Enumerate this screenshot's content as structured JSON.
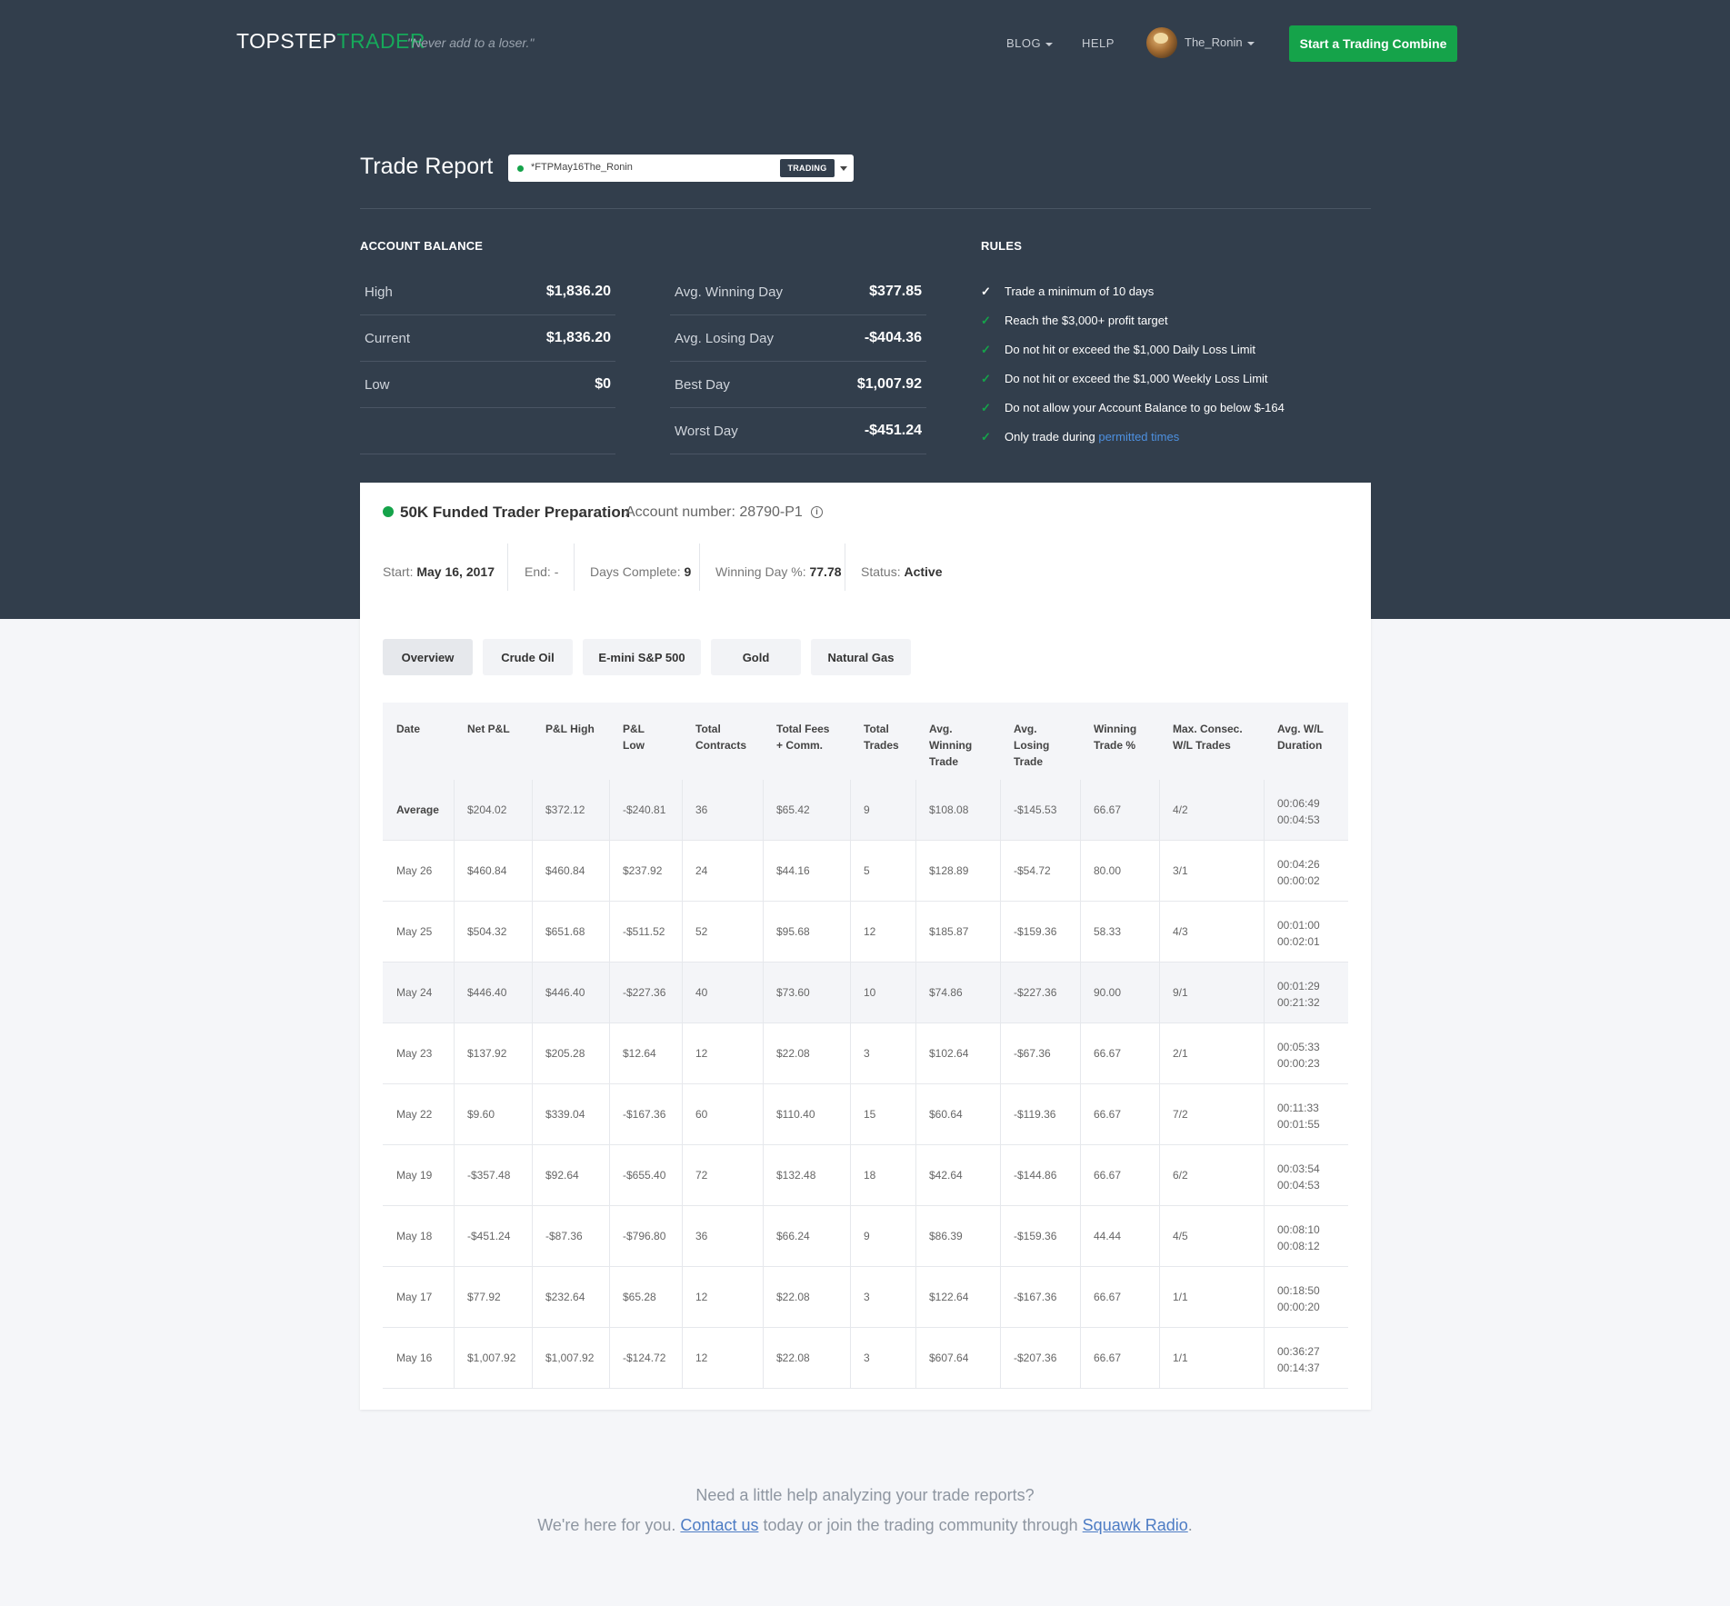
{
  "nav": {
    "logo_main": "TOPSTEP",
    "logo_accent": "TRADER",
    "tagline": "\"Never add to a loser.\"",
    "blog": "BLOG",
    "help": "HELP",
    "user": "The_Ronin",
    "cta": "Start a Trading Combine"
  },
  "report": {
    "title": "Trade Report",
    "account_select": "*FTPMay16The_Ronin",
    "account_badge": "TRADING"
  },
  "balance": {
    "heading": "ACCOUNT BALANCE",
    "left": [
      {
        "label": "High",
        "value": "$1,836.20"
      },
      {
        "label": "Current",
        "value": "$1,836.20"
      },
      {
        "label": "Low",
        "value": "$0"
      }
    ],
    "right": [
      {
        "label": "Avg. Winning Day",
        "value": "$377.85"
      },
      {
        "label": "Avg. Losing Day",
        "value": "-$404.36"
      },
      {
        "label": "Best Day",
        "value": "$1,007.92"
      },
      {
        "label": "Worst Day",
        "value": "-$451.24"
      }
    ]
  },
  "rules": {
    "heading": "RULES",
    "items": [
      "Trade a minimum of 10 days",
      "Reach the $3,000+ profit target",
      "Do not hit or exceed the $1,000 Daily Loss Limit",
      "Do not hit or exceed the $1,000 Weekly Loss Limit",
      "Do not allow your Account Balance to go below $-164"
    ],
    "last_prefix": "Only trade during ",
    "last_link": "permitted times"
  },
  "program": {
    "name": "50K Funded Trader Preparation",
    "account_number": "Account number: 28790-P1",
    "status_color": "#15a34a",
    "start_label": "Start:",
    "start": "May 16, 2017",
    "end_label": "End:",
    "end": "-",
    "days_label": "Days Complete:",
    "days": "9",
    "winpct_label": "Winning Day %:",
    "winpct": "77.78",
    "status_label": "Status:",
    "status": "Active"
  },
  "tabs": [
    "Overview",
    "Crude Oil",
    "E-mini S&P 500",
    "Gold",
    "Natural Gas"
  ],
  "table": {
    "headers": [
      "Date",
      "Net P&L",
      "P&L High",
      "P&L\nLow",
      "Total\nContracts",
      "Total Fees\n+ Comm.",
      "Total\nTrades",
      "Avg.\nWinning\nTrade",
      "Avg.\nLosing\nTrade",
      "Winning\nTrade %",
      "Max. Consec.\nW/L Trades",
      "Avg. W/L\nDuration"
    ],
    "rows": [
      [
        "Average",
        "$204.02",
        "$372.12",
        "-$240.81",
        "36",
        "$65.42",
        "9",
        "$108.08",
        "-$145.53",
        "66.67",
        "4/2",
        "00:06:49\n00:04:53"
      ],
      [
        "May 26",
        "$460.84",
        "$460.84",
        "$237.92",
        "24",
        "$44.16",
        "5",
        "$128.89",
        "-$54.72",
        "80.00",
        "3/1",
        "00:04:26\n00:00:02"
      ],
      [
        "May 25",
        "$504.32",
        "$651.68",
        "-$511.52",
        "52",
        "$95.68",
        "12",
        "$185.87",
        "-$159.36",
        "58.33",
        "4/3",
        "00:01:00\n00:02:01"
      ],
      [
        "May 24",
        "$446.40",
        "$446.40",
        "-$227.36",
        "40",
        "$73.60",
        "10",
        "$74.86",
        "-$227.36",
        "90.00",
        "9/1",
        "00:01:29\n00:21:32"
      ],
      [
        "May 23",
        "$137.92",
        "$205.28",
        "$12.64",
        "12",
        "$22.08",
        "3",
        "$102.64",
        "-$67.36",
        "66.67",
        "2/1",
        "00:05:33\n00:00:23"
      ],
      [
        "May 22",
        "$9.60",
        "$339.04",
        "-$167.36",
        "60",
        "$110.40",
        "15",
        "$60.64",
        "-$119.36",
        "66.67",
        "7/2",
        "00:11:33\n00:01:55"
      ],
      [
        "May 19",
        "-$357.48",
        "$92.64",
        "-$655.40",
        "72",
        "$132.48",
        "18",
        "$42.64",
        "-$144.86",
        "66.67",
        "6/2",
        "00:03:54\n00:04:53"
      ],
      [
        "May 18",
        "-$451.24",
        "-$87.36",
        "-$796.80",
        "36",
        "$66.24",
        "9",
        "$86.39",
        "-$159.36",
        "44.44",
        "4/5",
        "00:08:10\n00:08:12"
      ],
      [
        "May 17",
        "$77.92",
        "$232.64",
        "$65.28",
        "12",
        "$22.08",
        "3",
        "$122.64",
        "-$167.36",
        "66.67",
        "1/1",
        "00:18:50\n00:00:20"
      ],
      [
        "May 16",
        "$1,007.92",
        "$1,007.92",
        "-$124.72",
        "12",
        "$22.08",
        "3",
        "$607.64",
        "-$207.36",
        "66.67",
        "1/1",
        "00:36:27\n00:14:37"
      ]
    ]
  },
  "footer": {
    "line1": "Need a little help analyzing your trade reports?",
    "line2_a": "We're here for you. ",
    "contact": "Contact us",
    "line2_b": " today or join the trading community through ",
    "squawk": "Squawk Radio",
    "line2_c": "."
  }
}
